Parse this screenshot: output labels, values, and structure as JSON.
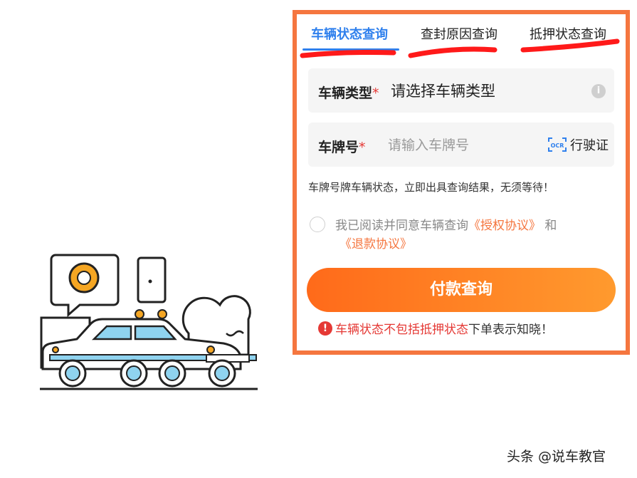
{
  "tabs": [
    {
      "label": "车辆状态查询",
      "active": true
    },
    {
      "label": "查封原因查询",
      "active": false
    },
    {
      "label": "抵押状态查询",
      "active": false
    }
  ],
  "vehicle_type": {
    "label": "车辆类型",
    "required_mark": "*",
    "value": "请选择车辆类型",
    "info_icon": "i"
  },
  "plate": {
    "label": "车牌号",
    "required_mark": "*",
    "placeholder": "请输入车牌号",
    "ocr_icon_text": "OCR",
    "ocr_label": "行驶证"
  },
  "hint": "车牌号牌车辆状态，立即出具查询结果，无须等待！",
  "agreement": {
    "prefix": "我已阅读并同意车辆查询",
    "link1": "《授权协议》",
    "conj": " 和",
    "link2": "《退款协议》"
  },
  "pay_button": "付款查询",
  "notice": {
    "icon": "!",
    "red_text": "车辆状态不包括抵押状态",
    "dark_text": "下单表示知晓！"
  },
  "watermark": "头条 @说车教官",
  "colors": {
    "accent_blue": "#2f80ed",
    "accent_orange": "#f5763f",
    "warning_red": "#e53935"
  }
}
